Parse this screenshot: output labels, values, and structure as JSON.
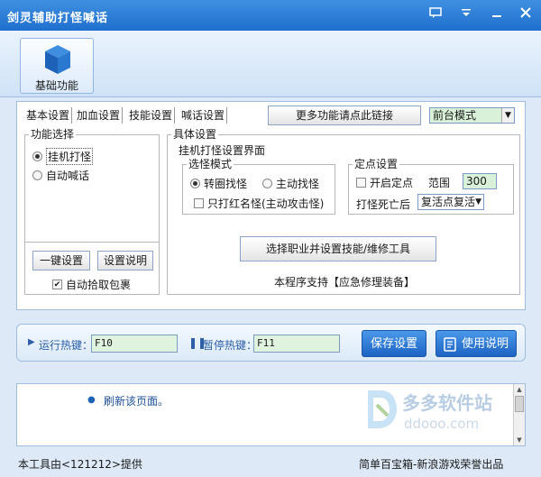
{
  "window": {
    "title": "剑灵辅助打怪喊话"
  },
  "ribbon": {
    "basic_label": "基础功能"
  },
  "tabs": [
    "基本设置",
    "加血设置",
    "技能设置",
    "喊话设置"
  ],
  "more_link": "更多功能请点此链接",
  "mode_select": {
    "value": "前台模式"
  },
  "function_group": {
    "title": "功能选择",
    "options": [
      "挂机打怪",
      "自动喊话"
    ],
    "selected": 0,
    "one_key_btn": "一键设置",
    "help_btn": "设置说明",
    "auto_pick": "自动拾取包裹"
  },
  "detail_group": {
    "title": "具体设置",
    "subtitle": "挂机打怪设置界面",
    "select_mode": {
      "title": "选怪模式",
      "options": [
        "转圈找怪",
        "主动找怪"
      ],
      "selected": 0,
      "red_only": "只打红名怪(主动攻击怪)"
    },
    "fixed_point": {
      "title": "定点设置",
      "enable": "开启定点",
      "range_label": "范围",
      "range_value": "300",
      "death_label": "打怪死亡后",
      "death_value": "复活点复活"
    },
    "job_btn": "选择职业并设置技能/维修工具",
    "support_text": "本程序支持【应急修理装备】"
  },
  "hotkeys": {
    "run_label": "运行热键：",
    "run_value": "F10",
    "pause_label": "暂停热键：",
    "pause_value": "F11",
    "save_btn": "保存设置",
    "help_btn": "使用说明"
  },
  "log": {
    "line": "刷新该页面。"
  },
  "watermark": {
    "brand": "多多软件站",
    "url": "ddooo.com"
  },
  "footer": {
    "left": "本工具由<121212>提供",
    "right": "简单百宝箱-新浪游戏荣誉出品"
  }
}
